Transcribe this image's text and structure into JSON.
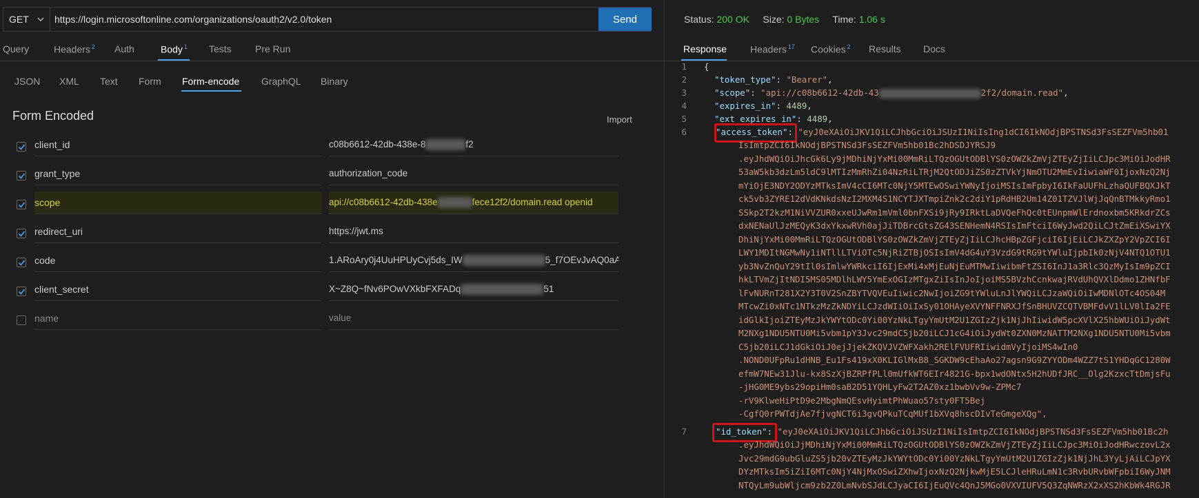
{
  "request": {
    "method": "GET",
    "url": "https://login.microsoftonline.com/organizations/oauth2/v2.0/token",
    "send_label": "Send"
  },
  "request_tabs": [
    {
      "label": "Query",
      "badge": ""
    },
    {
      "label": "Headers",
      "badge": "2"
    },
    {
      "label": "Auth",
      "badge": ""
    },
    {
      "label": "Body",
      "badge": "1"
    },
    {
      "label": "Tests",
      "badge": ""
    },
    {
      "label": "Pre Run",
      "badge": ""
    }
  ],
  "body_tabs": [
    "JSON",
    "XML",
    "Text",
    "Form",
    "Form-encode",
    "GraphQL",
    "Binary"
  ],
  "form": {
    "title": "Form Encoded",
    "import_label": "Import",
    "rows": [
      {
        "key": "client_id",
        "value_pre": "c08b6612-42db-438e-8",
        "value_post": "f2",
        "checked": true
      },
      {
        "key": "grant_type",
        "value_pre": "authorization_code",
        "value_post": "",
        "checked": true
      },
      {
        "key": "scope",
        "value_pre": "api://c08b6612-42db-438e",
        "value_post": "fece12f2/domain.read openid",
        "checked": true
      },
      {
        "key": "redirect_uri",
        "value_pre": "https://jwt.ms",
        "value_post": "",
        "checked": true
      },
      {
        "key": "code",
        "value_pre": "1.ARoAry0j4UuHPUyCvj5ds_IW",
        "value_post": "5_f7OEvJvAQ0aAA",
        "checked": true
      },
      {
        "key": "client_secret",
        "value_pre": "X~Z8Q~fNv6POwVXkbFXFADq",
        "value_post": "51",
        "checked": true
      },
      {
        "key": "name",
        "value_pre": "value",
        "value_post": "",
        "checked": false
      }
    ]
  },
  "response": {
    "status_label": "Status:",
    "status_value": "200 OK",
    "size_label": "Size:",
    "size_value": "0 Bytes",
    "time_label": "Time:",
    "time_value": "1.06 s",
    "tabs": [
      {
        "label": "Response",
        "badge": ""
      },
      {
        "label": "Headers",
        "badge": "17"
      },
      {
        "label": "Cookies",
        "badge": "2"
      },
      {
        "label": "Results",
        "badge": ""
      },
      {
        "label": "Docs",
        "badge": ""
      }
    ],
    "lines": {
      "l1": "{",
      "token_type_key": "\"token_type\"",
      "token_type_val": "\"Bearer\"",
      "scope_key": "\"scope\"",
      "scope_val_pre": "\"api://c08b6612-42db-43",
      "scope_val_post": "2f2/domain.read\"",
      "expires_in_key": "\"expires_in\"",
      "expires_in_val": "4489",
      "ext_expires_in_key": "\"ext_expires_in\"",
      "ext_expires_in_val": "4489",
      "access_token_key": "\"access_token\"",
      "access_token_first": "\"eyJ0eXAiOiJKV1QiLCJhbGciOiJSUzI1NiIsIng1dCI6IkNOdjBPSTNSd3FsSEZFVm5hb01",
      "id_token_key": "\"id_token\"",
      "id_token_first": "\"eyJ0eXAiOiJKV1QiLCJhbGciOiJSUzI1NiIsImtpZCI6IkNOdjBPSTNSd3FsSEZFVm5hb01Bc2h"
    },
    "access_token_lines": [
      "IsImtpZCI6IkNOdjBPSTNSd3FsSEZFVm5hb01Bc2hDSDJYRSJ9",
      ".eyJhdWQiOiJhcGk6Ly9jMDhiNjYxMi00MmRiLTQzOGUtODBlYS0zOWZkZmVjZTEyZjIiLCJpc3MiOiJodHR",
      "53aW5kb3dzLm5ldC9lMTIzMmRhZi04NzRiLTRjM2QtODJiZS0zZTVkYjNmOTU2MmEvIiwiaWF0IjoxNzQ2Nj",
      "mYiOjE3NDY2ODYzMTksImV4cCI6MTc0NjY5MTEwOSwiYWNyIjoiMSIsImFpbyI6IkFaUUFhLzhaQUFBQXJkT",
      "ck5vb3ZYRE12dVdKNkdsNzI2MXM4S1NCYTJXTmpiZnk2c2diY1pRdHB2Um14Z01TZVJlWjJqQnBTMkkyRmo1",
      "SSkp2T2kzM1NiVVZUR0xxeUJwRm1mVml0bnFXSi9jRy9IRktLaDVQeFhQc0tEUnpmWlErdnoxbm5KRkdrZCs",
      "dxNENaUlJzMEQyK3dxYkxwRVh0ajJiTDBrcGtsZG43SENHemN4RSIsImFtciI6WyJwd2QiLCJtZmEiXSwiYX",
      "DhiNjYxMi00MmRiLTQzOGUtODBlYS0zOWZkZmVjZTEyZjIiLCJhcHBpZGFjciI6IjEiLCJkZXZpY2VpZCI6I",
      "LWY1MDItNGMwNy1iNTllLTViOTc5NjRiZTBjOSIsImV4dG4uY3VzdG9tRG9tYWluIjpbIk0zNjV4NTQ1OTU1",
      "yb3NvZnQuY29tIl0sImlwYWRkciI6IjExMi4xMjEuNjEuMTMwIiwibmFtZSI6InJ1a3Rlc3QzMyIsIm9pZCI",
      "hkLTVmZjItNDI5MS05MDlhLWY5YmExOGIzMTgxZiIsInJoIjoiMS5BVzhCcnkwajRVdUhQVXlDdmo1ZHNfbF",
      "lFvNURnT281X2Y3T0V2SnZBYTVQVEuIiwic2NwIjoiZG9tYWluLnJlYWQiLCJzaWQiOiIwMDNlOTc4OS04M",
      "MTcwZi0xNTc1NTkzMzZkNDYiLCJzdWIiOiIxSy01OHAyeXVYNFFNRXJfSnBHUVZCQTVBMFdvV1lLV0lIa2FE",
      "idGlkIjoiZTEyMzJkYWYtODc0Yi00YzNkLTgyYmUtM2U1ZGIzZjk1NjJhIiwidW5pcXVlX25hbWUiOiJydWt",
      "M2NXg1NDU5NTU0Mi5vbm1pY3Jvc29mdC5jb20iLCJ1cG4iOiJydWt0ZXN0MzNATTM2NXg1NDU5NTU0Mi5vbm",
      "C5jb20iLCJ1dGkiOiJ0ejJjekZKQVJVZWFXakh2RElFVUFRIiwidmVyIjoiMS4wIn0",
      ".NOND0UFpRu1dHNB_Eu1Fs419xX0KLIGlMxB8_SGKDW9cEhaAo27agsn9G9ZYYODm4WZZ7tS1YHDqGC1280W",
      "efmW7NEw31Jlu-kx8SzXjBZRPfPLl0mUfkWT6EIr4821G-bpx1wdONtx5H2hUDfJRC__Olg2KzxcTtDmjsFu",
      "-jHG0ME9ybs29opiHm0saB2D51YQHLyFw2T2AZ0xz1bwbVv9w-ZPMc7",
      "-rV9KlweHiPtD9e2MbgNmQEsvHyimtPhWuao57sty0FT5Bej",
      "-CgfQ0rPWTdjAe7fjvgNCT6i3gvQPkuTCqMUf1bXVq8hscDIvTeGmgeXQg\","
    ],
    "id_token_lines": [
      ".eyJhdWQiOiJjMDhiNjYxMi00MmRiLTQzOGUtODBlYS0zOWZkZmVjZTEyZjIiLCJpc3MiOiJodHRwczovL2x",
      "Jvc29mdG9ubGluZS5jb20vZTEyMzJkYWYtODc0Yi00YzNkLTgyYmUtM2U1ZGIzZjk1NjJhL3YyLjAiLCJpYX",
      "DYzMTksIm5iZiI6MTc0NjY4NjMxOSwiZXhwIjoxNzQ2NjkwMjE5LCJleHRuLmN1c3RvbURvbWFpbiI6WyJNM",
      "NTQyLm9ubWljcm9zb2Z0LmNvbSJdLCJyaCI6IjEuQVc4QnJ5MGo0VXVIUFV5Q3ZqNWRzX2xXS2hKbWk4RGJR"
    ]
  }
}
